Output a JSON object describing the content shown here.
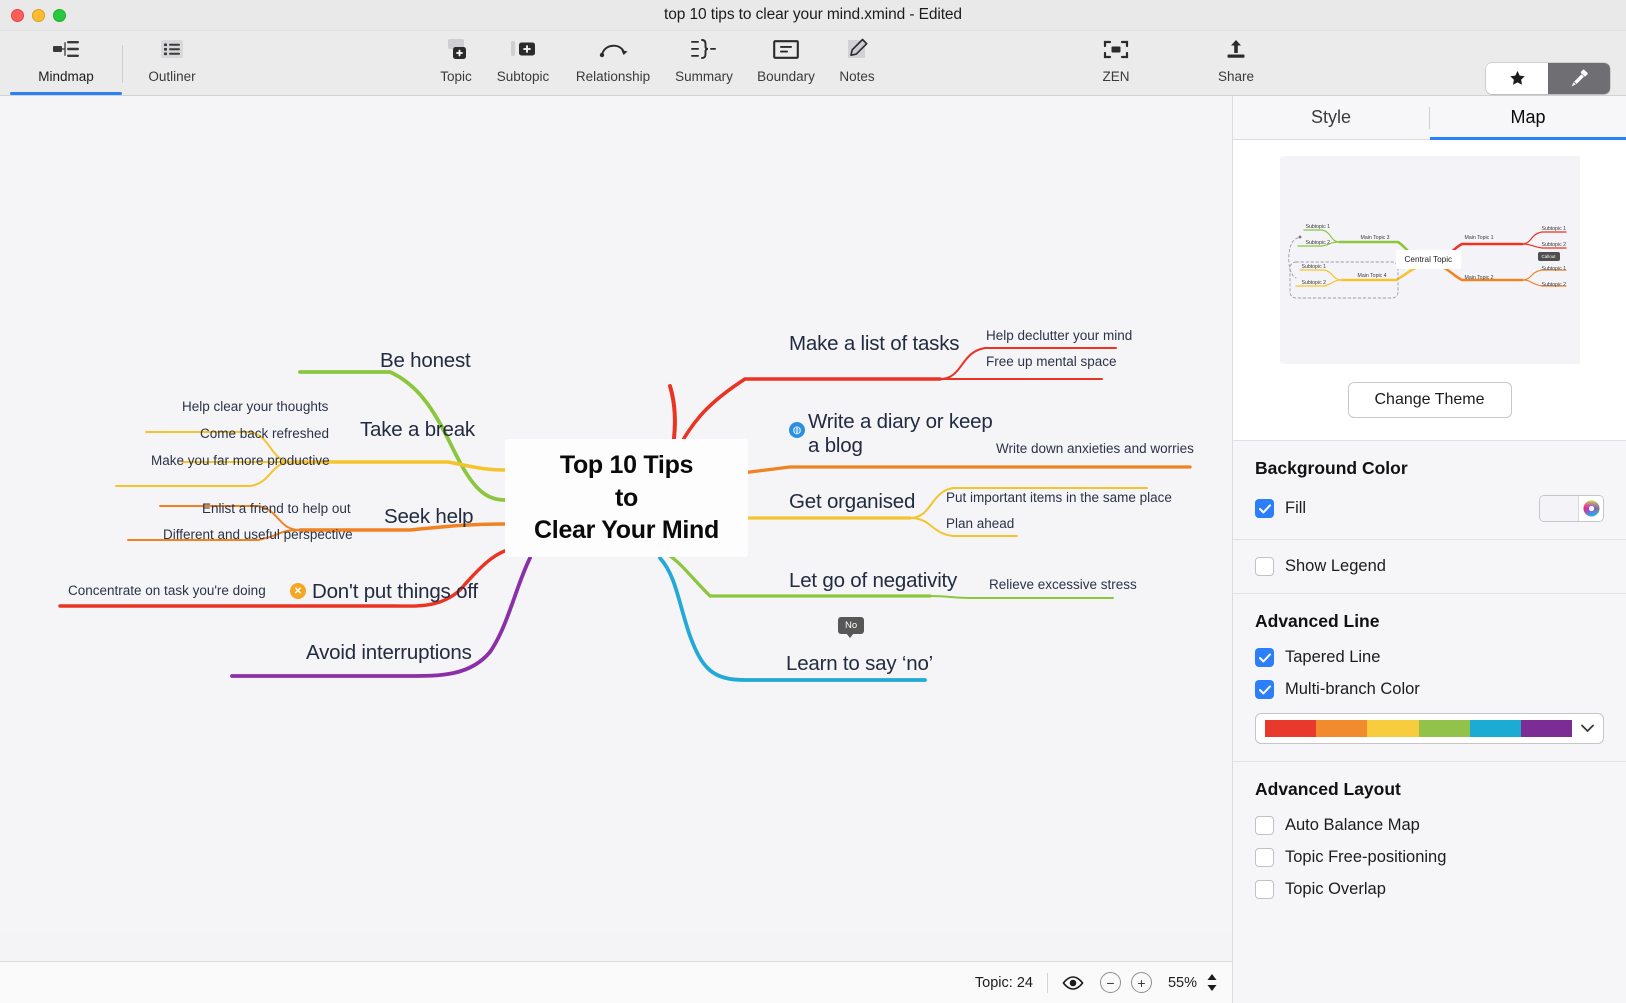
{
  "window": {
    "title": "top 10 tips to clear your mind.xmind - Edited",
    "traffic_lights": [
      "close-button",
      "minimize-button",
      "maximize-button"
    ]
  },
  "toolbar": {
    "items": [
      {
        "label": "Mindmap",
        "icon": "mindmap-icon",
        "active": true
      },
      {
        "label": "Outliner",
        "icon": "outliner-icon",
        "active": false
      },
      {
        "label": "Topic",
        "icon": "topic-icon",
        "active": false
      },
      {
        "label": "Subtopic",
        "icon": "subtopic-icon",
        "active": false
      },
      {
        "label": "Relationship",
        "icon": "relationship-icon",
        "active": false
      },
      {
        "label": "Summary",
        "icon": "summary-icon",
        "active": false
      },
      {
        "label": "Boundary",
        "icon": "boundary-icon",
        "active": false
      },
      {
        "label": "Notes",
        "icon": "notes-icon",
        "active": false
      },
      {
        "label": "ZEN",
        "icon": "zen-icon",
        "active": false
      },
      {
        "label": "Share",
        "icon": "share-icon",
        "active": false
      }
    ],
    "segmented": {
      "icon_label": "Icon",
      "format_label": "Format",
      "icon_glyph": "star-icon",
      "format_glyph": "paintbrush-icon",
      "selected": "Format"
    },
    "accent": "#2d7ff9"
  },
  "mindmap": {
    "central_topic": [
      "Top 10 Tips",
      "to",
      "Clear Your Mind"
    ],
    "branches": [
      {
        "label": "Make a list of tasks",
        "side": "right",
        "color": "#ea3323",
        "subtopics": [
          "Help declutter your mind",
          "Free up mental space"
        ],
        "marker": null
      },
      {
        "label": "Write a diary or keep a blog",
        "side": "right",
        "color": "#f08222",
        "subtopics": [
          "Write down anxieties and worries"
        ],
        "marker": "flag-blue-icon"
      },
      {
        "label": "Get organised",
        "side": "right",
        "color": "#f5c32c",
        "subtopics": [
          "Put important items in the same place",
          "Plan ahead"
        ],
        "marker": null
      },
      {
        "label": "Let go of negativity",
        "side": "right",
        "color": "#8cc63e",
        "subtopics": [
          "Relieve excessive stress"
        ],
        "marker": null
      },
      {
        "label": "Learn to say ‘no’",
        "side": "right",
        "color": "#23a9d8",
        "subtopics": [],
        "marker": "label-no-tag",
        "marker_text": "No"
      },
      {
        "label": "Be honest",
        "side": "left",
        "color": "#8cc63e",
        "subtopics": [],
        "marker": null
      },
      {
        "label": "Take a break",
        "side": "left",
        "color": "#f5c32c",
        "subtopics": [
          "Help clear your thoughts",
          "Come back refreshed",
          "Make you far more productive"
        ],
        "marker": null
      },
      {
        "label": "Seek help",
        "side": "left",
        "color": "#f08222",
        "subtopics": [
          "Enlist a friend to help out",
          "Different and useful perspective"
        ],
        "marker": null
      },
      {
        "label": "Don't put things off",
        "side": "left",
        "color": "#ea3323",
        "subtopics": [
          "Concentrate on task you're doing"
        ],
        "marker": "x-orange-icon",
        "marker_text": "✕"
      },
      {
        "label": "Avoid interruptions",
        "side": "left",
        "color": "#8b2fa8",
        "subtopics": [],
        "marker": null
      }
    ]
  },
  "statusbar": {
    "topic_count_label": "Topic: 24",
    "visibility_icon": "eye-icon",
    "zoom_out_label": "−",
    "zoom_in_label": "+",
    "zoom_level": "55%",
    "stepper_icon": "stepper-updown-icon"
  },
  "panel": {
    "tabs": [
      {
        "label": "Style",
        "active": false
      },
      {
        "label": "Map",
        "active": true
      }
    ],
    "theme_preview": {
      "central": "Central Topic",
      "main_topics": [
        "Main Topic 1",
        "Main Topic 2",
        "Main Topic 3",
        "Main Topic 4"
      ],
      "subtopics": [
        "Subtopic 1",
        "Subtopic 2"
      ],
      "callout": "Callout"
    },
    "change_theme_label": "Change Theme",
    "sections": [
      {
        "title": "Background Color",
        "rows": [
          {
            "label": "Fill",
            "checked": true,
            "has_color_well": true
          }
        ],
        "swatch_color": "#f4f4f8"
      },
      {
        "title": "",
        "rows": [
          {
            "label": "Show Legend",
            "checked": false,
            "has_color_well": false
          }
        ]
      },
      {
        "title": "Advanced Line",
        "rows": [
          {
            "label": "Tapered Line",
            "checked": true,
            "has_color_well": false
          },
          {
            "label": "Multi-branch Color",
            "checked": true,
            "has_color_well": false
          }
        ],
        "palette": [
          "#e8392c",
          "#f28a2e",
          "#f7cc3e",
          "#92c24a",
          "#1cabd2",
          "#7b2d95"
        ],
        "chevron": "chevron-down-icon"
      },
      {
        "title": "Advanced Layout",
        "rows": [
          {
            "label": "Auto Balance Map",
            "checked": false,
            "has_color_well": false
          },
          {
            "label": "Topic Free-positioning",
            "checked": false,
            "has_color_well": false
          },
          {
            "label": "Topic Overlap",
            "checked": false,
            "has_color_well": false
          }
        ]
      }
    ]
  }
}
